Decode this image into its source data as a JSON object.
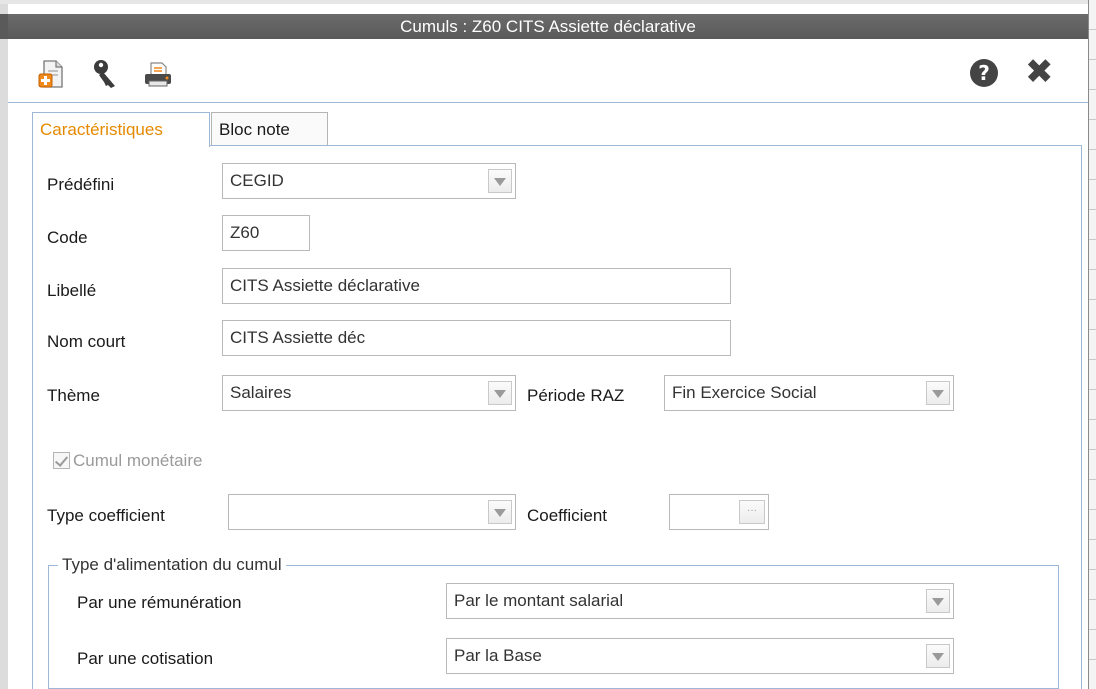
{
  "window": {
    "title": "Cumuls  : Z60 CITS Assiette déclarative"
  },
  "toolbar": {
    "icons": [
      "new-document-icon",
      "key-icon",
      "printer-icon",
      "help-icon",
      "close-icon"
    ],
    "help_glyph": "?",
    "close_glyph": "✖"
  },
  "tabs": [
    {
      "label": "Caractéristiques",
      "active": true
    },
    {
      "label": "Bloc note",
      "active": false
    }
  ],
  "form": {
    "predefini": {
      "label": "Prédéfini",
      "value": "CEGID"
    },
    "code": {
      "label": "Code",
      "value": "Z60"
    },
    "libelle": {
      "label": "Libellé",
      "value": "CITS Assiette déclarative"
    },
    "nom_court": {
      "label": "Nom court",
      "value": "CITS Assiette déc"
    },
    "theme": {
      "label": "Thème",
      "value": "Salaires"
    },
    "periode_raz": {
      "label": "Période RAZ",
      "value": "Fin Exercice Social"
    },
    "cumul_monetaire": {
      "label": "Cumul monétaire",
      "checked": true,
      "disabled": true
    },
    "type_coefficient": {
      "label": "Type coefficient",
      "value": ""
    },
    "coefficient": {
      "label": "Coefficient",
      "value": "",
      "button_glyph": "···"
    }
  },
  "alimentation": {
    "title": "Type d'alimentation du cumul",
    "remuneration": {
      "label": "Par une rémunération",
      "value": "Par le montant salarial"
    },
    "cotisation": {
      "label": "Par une cotisation",
      "value": "Par la Base"
    }
  },
  "colors": {
    "accent_tab": "#e58a00",
    "border_blue": "#9db8d6",
    "titlebar": "#5f5f5f"
  }
}
